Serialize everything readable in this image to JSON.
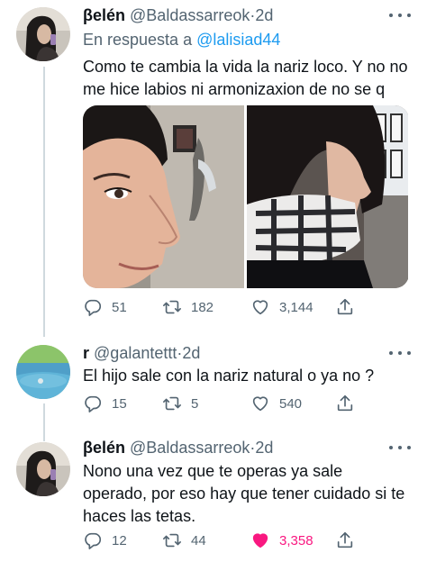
{
  "tweets": [
    {
      "name": "βelén",
      "handle": "@Baldassarreok",
      "separator": "·",
      "time": "2d",
      "reply_prefix": "En respuesta a",
      "reply_mention": "@lalisiad44",
      "text_line1": "Como te cambia la vida la nariz loco. Y no no",
      "text_line2": "me hice labios ni armonizaxion de no se q",
      "replies": "51",
      "retweets": "182",
      "likes": "3,144"
    },
    {
      "name": "r",
      "handle": "@galantettt",
      "separator": "·",
      "time": "2d",
      "text_line1": "El hijo sale con la nariz natural o ya no ?",
      "replies": "15",
      "retweets": "5",
      "likes": "540"
    },
    {
      "name": "βelén",
      "handle": "@Baldassarreok",
      "separator": "·",
      "time": "2d",
      "text_line1": "Nono una vez que te operas ya sale",
      "text_line2": "operado, por eso hay que tener cuidado si te",
      "text_line3": "haces las tetas.",
      "replies": "12",
      "retweets": "44",
      "likes": "3,358"
    }
  ],
  "icons": {
    "reply": "reply-icon",
    "retweet": "retweet-icon",
    "like": "heart-icon",
    "share": "share-icon",
    "more": "more-icon"
  },
  "colors": {
    "link": "#1d9bf0",
    "secondary_text": "#536471",
    "liked": "#f91880",
    "thread_line": "#cfd9de"
  }
}
